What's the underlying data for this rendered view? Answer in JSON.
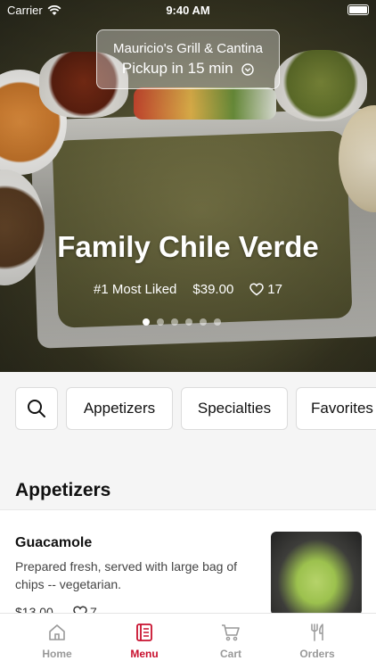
{
  "status": {
    "carrier": "Carrier",
    "time": "9:40 AM"
  },
  "pickup": {
    "restaurant": "Mauricio's Grill & Cantina",
    "eta": "Pickup in 15 min"
  },
  "hero": {
    "title": "Family Chile Verde",
    "badge": "#1 Most Liked",
    "price": "$39.00",
    "likes": "17",
    "slides": 6,
    "active_slide": 1
  },
  "categories": {
    "items": [
      "Appetizers",
      "Specialties",
      "Favorites"
    ]
  },
  "section": {
    "title": "Appetizers"
  },
  "item": {
    "name": "Guacamole",
    "description": "Prepared fresh, served with large bag of chips -- vegetarian.",
    "price": "$13.00",
    "likes": "7"
  },
  "tabs": [
    {
      "label": "Home",
      "icon": "home-icon"
    },
    {
      "label": "Menu",
      "icon": "menu-icon",
      "active": true
    },
    {
      "label": "Cart",
      "icon": "cart-icon"
    },
    {
      "label": "Orders",
      "icon": "utensils-icon"
    }
  ],
  "colors": {
    "accent": "#c8102e",
    "inactive": "#999999"
  }
}
